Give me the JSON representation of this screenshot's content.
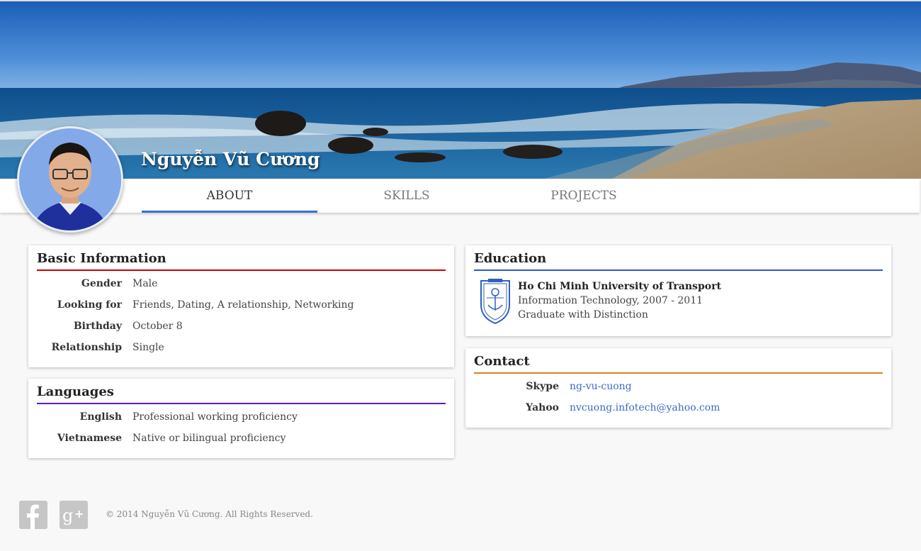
{
  "profile": {
    "name": "Nguyễn Vũ Cương"
  },
  "nav": {
    "tabs": [
      {
        "label": "ABOUT",
        "active": true
      },
      {
        "label": "SKILLS",
        "active": false
      },
      {
        "label": "PROJECTS",
        "active": false
      }
    ]
  },
  "basic_info": {
    "title": "Basic Information",
    "rows": [
      {
        "label": "Gender",
        "value": "Male"
      },
      {
        "label": "Looking for",
        "value": "Friends, Dating, A relationship, Networking"
      },
      {
        "label": "Birthday",
        "value": "October 8"
      },
      {
        "label": "Relationship",
        "value": "Single"
      }
    ]
  },
  "languages": {
    "title": "Languages",
    "rows": [
      {
        "label": "English",
        "value": "Professional working proficiency"
      },
      {
        "label": "Vietnamese",
        "value": "Native or bilingual proficiency"
      }
    ]
  },
  "education": {
    "title": "Education",
    "school": "Ho Chi Minh University of Transport",
    "program": "Information Technology, 2007 - 2011",
    "note": "Graduate with Distinction"
  },
  "contact": {
    "title": "Contact",
    "rows": [
      {
        "label": "Skype",
        "value": "ng-vu-cuong"
      },
      {
        "label": "Yahoo",
        "value": "nvcuong.infotech@yahoo.com"
      }
    ]
  },
  "footer": {
    "copyright": "© 2014 Nguyễn Vũ Cương. All Rights Reserved.",
    "social": [
      {
        "icon": "facebook-icon"
      },
      {
        "icon": "google-plus-icon"
      }
    ]
  },
  "colors": {
    "accent": "#3b6fcf",
    "basic_info_rule": "#cc0000",
    "languages_rule": "#6a1aa6",
    "education_rule": "#2b57c9",
    "contact_rule": "#e07e1c",
    "link": "#3b6bc9"
  }
}
